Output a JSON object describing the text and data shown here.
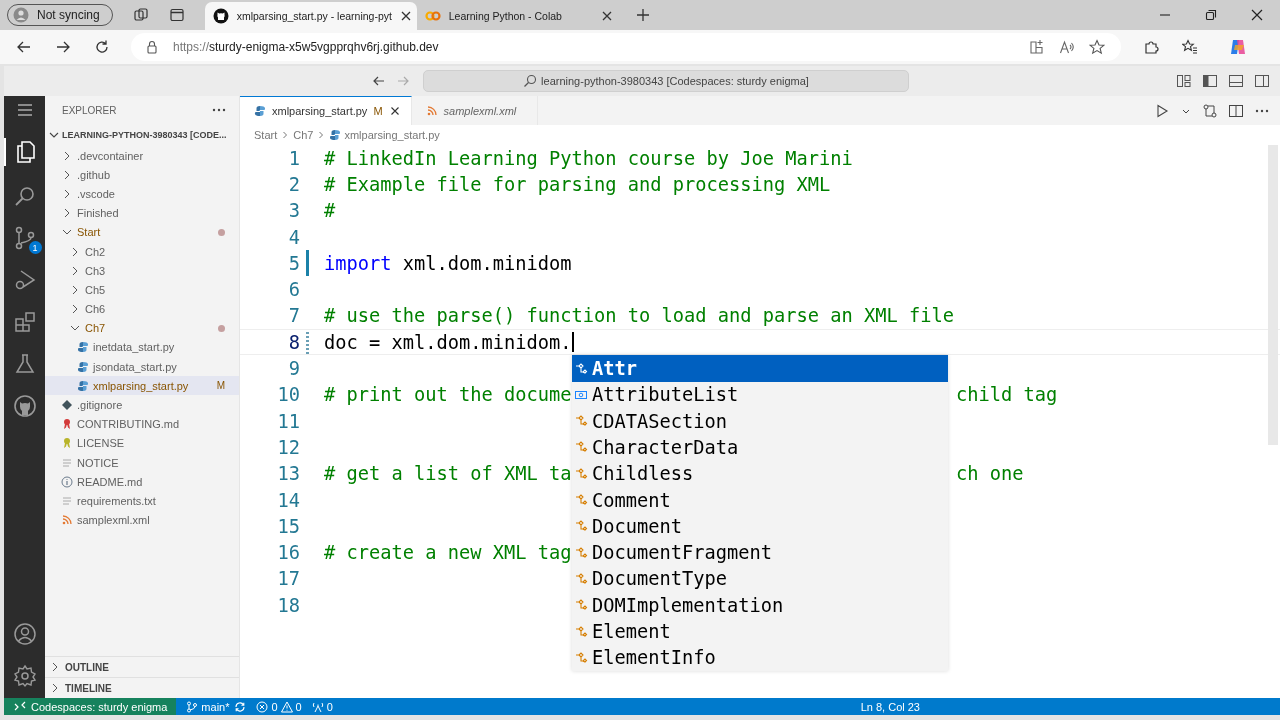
{
  "browser": {
    "profile": "Not syncing",
    "tabs": [
      {
        "title": "xmlparsing_start.py - learning-pyt",
        "kind": "github",
        "selected": true
      },
      {
        "title": "Learning Python - Colab",
        "kind": "colab",
        "selected": false
      }
    ],
    "url_scheme": "https://",
    "url_host": "sturdy-enigma-x5w5vgpprqhv6rj.github.dev"
  },
  "title_bar": {
    "command_center": "learning-python-3980343 [Codespaces: sturdy enigma]"
  },
  "activity_bar": {
    "source_control_badge": "1"
  },
  "explorer": {
    "title": "EXPLORER",
    "root": "LEARNING-PYTHON-3980343 [CODE...",
    "tree": [
      {
        "label": ".devcontainer",
        "kind": "folder",
        "expanded": false,
        "selected": false,
        "modified": false
      },
      {
        "label": ".github",
        "kind": "folder",
        "expanded": false,
        "selected": false,
        "modified": false
      },
      {
        "label": ".vscode",
        "kind": "folder",
        "expanded": false,
        "selected": false,
        "modified": false
      },
      {
        "label": "Finished",
        "kind": "folder",
        "expanded": false,
        "selected": false,
        "modified": false
      },
      {
        "label": "Start",
        "kind": "folder",
        "expanded": true,
        "selected": false,
        "modified": true,
        "children": [
          {
            "label": "Ch2",
            "kind": "folder",
            "expanded": false,
            "selected": false,
            "modified": false
          },
          {
            "label": "Ch3",
            "kind": "folder",
            "expanded": false,
            "selected": false,
            "modified": false
          },
          {
            "label": "Ch5",
            "kind": "folder",
            "expanded": false,
            "selected": false,
            "modified": false
          },
          {
            "label": "Ch6",
            "kind": "folder",
            "expanded": false,
            "selected": false,
            "modified": false
          },
          {
            "label": "Ch7",
            "kind": "folder",
            "expanded": true,
            "selected": false,
            "modified": true,
            "children": [
              {
                "label": "inetdata_start.py",
                "kind": "python",
                "selected": false,
                "modified": false
              },
              {
                "label": "jsondata_start.py",
                "kind": "python",
                "selected": false,
                "modified": false
              },
              {
                "label": "xmlparsing_start.py",
                "kind": "python",
                "selected": true,
                "modified": true,
                "badge": "M"
              }
            ]
          }
        ]
      },
      {
        "label": ".gitignore",
        "kind": "git",
        "selected": false,
        "modified": false
      },
      {
        "label": "CONTRIBUTING.md",
        "kind": "ribbon",
        "selected": false,
        "modified": false
      },
      {
        "label": "LICENSE",
        "kind": "license",
        "selected": false,
        "modified": false
      },
      {
        "label": "NOTICE",
        "kind": "text",
        "selected": false,
        "modified": false
      },
      {
        "label": "README.md",
        "kind": "info",
        "selected": false,
        "modified": false
      },
      {
        "label": "requirements.txt",
        "kind": "text",
        "selected": false,
        "modified": false
      },
      {
        "label": "samplexml.xml",
        "kind": "rss",
        "selected": false,
        "modified": false
      }
    ],
    "panels": [
      "OUTLINE",
      "TIMELINE"
    ]
  },
  "editor": {
    "tabs": [
      {
        "label": "xmlparsing_start.py",
        "kind": "python",
        "badge": "M",
        "selected": true,
        "preview": false
      },
      {
        "label": "samplexml.xml",
        "kind": "rss",
        "selected": false,
        "preview": true
      }
    ],
    "breadcrumbs": [
      "Start",
      "Ch7",
      "xmlparsing_start.py"
    ],
    "lines": [
      {
        "number": "1",
        "current": false,
        "changed": false,
        "edited": false,
        "tokens": [
          {
            "kind": "comment",
            "text": "# LinkedIn Learning Python course by Joe Marini"
          }
        ]
      },
      {
        "number": "2",
        "current": false,
        "changed": false,
        "edited": false,
        "tokens": [
          {
            "kind": "comment",
            "text": "# Example file for parsing and processing XML"
          }
        ]
      },
      {
        "number": "3",
        "current": false,
        "changed": false,
        "edited": false,
        "tokens": [
          {
            "kind": "comment",
            "text": "#"
          }
        ]
      },
      {
        "number": "4",
        "current": false,
        "changed": false,
        "edited": false
      },
      {
        "number": "5",
        "current": false,
        "changed": true,
        "edited": false,
        "tokens": [
          {
            "kind": "keyword",
            "text": "import"
          },
          {
            "kind": "plain",
            "text": " xml.dom.minidom"
          }
        ]
      },
      {
        "number": "6",
        "current": false,
        "changed": false,
        "edited": false
      },
      {
        "number": "7",
        "current": false,
        "changed": false,
        "edited": false,
        "tokens": [
          {
            "kind": "comment",
            "text": "# use the parse() function to load and parse an XML file"
          }
        ]
      },
      {
        "number": "8",
        "current": true,
        "changed": false,
        "edited": true,
        "tokens": [
          {
            "kind": "plain",
            "text": "doc = xml.dom.minidom."
          }
        ]
      },
      {
        "number": "9",
        "current": false,
        "changed": false,
        "edited": false
      },
      {
        "number": "10",
        "current": false,
        "changed": false,
        "edited": false,
        "tokens": [
          {
            "kind": "comment",
            "text": "# print out the docume"
          }
        ],
        "tail": "child tag"
      },
      {
        "number": "11",
        "current": false,
        "changed": false,
        "edited": false
      },
      {
        "number": "12",
        "current": false,
        "changed": false,
        "edited": false
      },
      {
        "number": "13",
        "current": false,
        "changed": false,
        "edited": false,
        "tokens": [
          {
            "kind": "comment",
            "text": "# get a list of XML ta"
          }
        ],
        "tail": "ch one"
      },
      {
        "number": "14",
        "current": false,
        "changed": false,
        "edited": false
      },
      {
        "number": "15",
        "current": false,
        "changed": false,
        "edited": false
      },
      {
        "number": "16",
        "current": false,
        "changed": false,
        "edited": false,
        "tokens": [
          {
            "kind": "comment",
            "text": "# create a new XML tag"
          }
        ]
      },
      {
        "number": "17",
        "current": false,
        "changed": false,
        "edited": false
      },
      {
        "number": "18",
        "current": false,
        "changed": false,
        "edited": false
      }
    ],
    "suggestions": [
      {
        "label": "Attr",
        "kind": "class",
        "selected": true
      },
      {
        "label": "AttributeList",
        "kind": "field",
        "selected": false
      },
      {
        "label": "CDATASection",
        "kind": "class",
        "selected": false
      },
      {
        "label": "CharacterData",
        "kind": "class",
        "selected": false
      },
      {
        "label": "Childless",
        "kind": "class",
        "selected": false
      },
      {
        "label": "Comment",
        "kind": "class",
        "selected": false
      },
      {
        "label": "Document",
        "kind": "class",
        "selected": false
      },
      {
        "label": "DocumentFragment",
        "kind": "class",
        "selected": false
      },
      {
        "label": "DocumentType",
        "kind": "class",
        "selected": false
      },
      {
        "label": "DOMImplementation",
        "kind": "class",
        "selected": false
      },
      {
        "label": "Element",
        "kind": "class",
        "selected": false
      },
      {
        "label": "ElementInfo",
        "kind": "class",
        "selected": false
      }
    ]
  },
  "status_bar": {
    "remote": "Codespaces: sturdy enigma",
    "branch": "main*",
    "errors": "0",
    "warnings": "0",
    "ports": "0",
    "position": "Ln 8, Col 23"
  }
}
